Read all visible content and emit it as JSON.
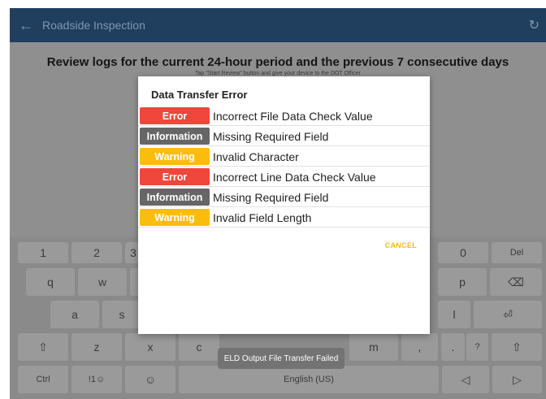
{
  "appbar": {
    "title": "Roadside Inspection",
    "back_icon": "arrow-back-icon",
    "refresh_icon": "refresh-icon"
  },
  "content": {
    "heading": "Review logs for the current 24-hour period and the previous 7 consecutive days",
    "subtext": "Tap \"Start Review\" button and give your device to the DOT Officer"
  },
  "dialog": {
    "title": "Data Transfer Error",
    "rows": [
      {
        "type": "Error",
        "message": "Incorrect File Data Check Value"
      },
      {
        "type": "Information",
        "message": "Missing Required Field"
      },
      {
        "type": "Warning",
        "message": "Invalid Character"
      },
      {
        "type": "Error",
        "message": "Incorrect Line Data Check Value"
      },
      {
        "type": "Information",
        "message": "Missing Required Field"
      },
      {
        "type": "Warning",
        "message": "Invalid Field Length"
      }
    ],
    "cancel_label": "CANCEL"
  },
  "keyboard": {
    "row1": [
      "1",
      "2",
      "3",
      "0",
      "Del"
    ],
    "row2": [
      "q",
      "w",
      "p",
      "⌫"
    ],
    "row3": [
      "a",
      "s",
      "l",
      "⏎"
    ],
    "row4": [
      "⇧",
      "z",
      "x",
      "c",
      "m",
      ",",
      ".",
      "?",
      "⇧"
    ],
    "row5": [
      "Ctrl",
      "!1☺",
      "☺",
      "English (US)",
      "◁",
      "▷"
    ]
  },
  "toast": "ELD Output File Transfer Failed",
  "colors": {
    "error": "#f0463c",
    "information": "#666666",
    "warning": "#fbbd0b",
    "appbar": "#203f5f"
  }
}
